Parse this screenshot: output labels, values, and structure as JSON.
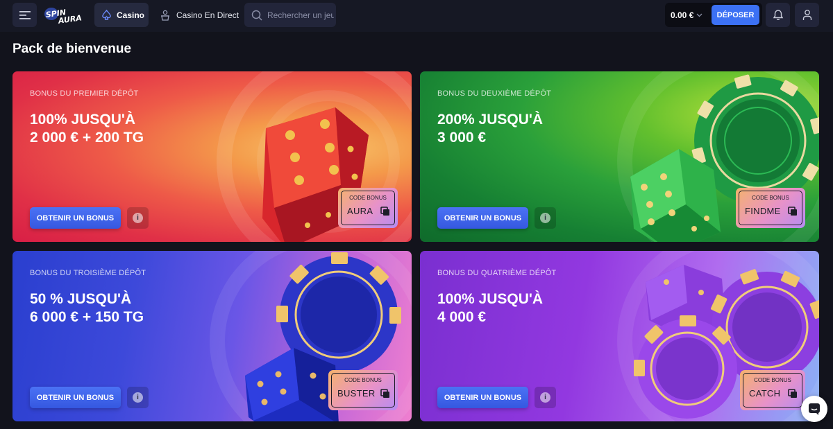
{
  "header": {
    "logo_text": "SPIN AURA",
    "nav": {
      "casino_label": "Casino",
      "live_label": "Casino En Direct"
    },
    "search": {
      "placeholder": "Rechercher un jeu"
    },
    "balance": "0.00 €",
    "deposit_label": "DÉPOSER"
  },
  "page_title": "Pack de bienvenue",
  "cards": [
    {
      "label": "BONUS DU PREMIER DÉPÔT",
      "line1": "100% JUSQU'À",
      "line2": "2 000 € + 200 TG",
      "cta": "OBTENIR UN BONUS",
      "code_label": "CODE BONUS",
      "code": "AURA",
      "theme": "red"
    },
    {
      "label": "BONUS DU DEUXIÈME DÉPÔT",
      "line1": "200% JUSQU'À",
      "line2": "3 000 €",
      "cta": "OBTENIR UN BONUS",
      "code_label": "CODE BONUS",
      "code": "FINDME",
      "theme": "green"
    },
    {
      "label": "BONUS DU TROISIÈME DÉPÔT",
      "line1": "50 % JUSQU'À",
      "line2": "6 000 € + 150 TG",
      "cta": "OBTENIR UN BONUS",
      "code_label": "CODE BONUS",
      "code": "BUSTER",
      "theme": "blue"
    },
    {
      "label": "BONUS DU QUATRIÈME DÉPÔT",
      "line1": "100% JUSQU'À",
      "line2": "4 000 €",
      "cta": "OBTENIR UN BONUS",
      "code_label": "CODE BONUS",
      "code": "CATCH",
      "theme": "purple"
    }
  ],
  "colors": {
    "background": "#12131c",
    "header": "#161824",
    "accent": "#3c71f4",
    "card_red": "#e8374a",
    "card_green": "#1f8a3a",
    "card_blue": "#3f4fd8",
    "card_purple": "#9a3de0"
  },
  "icons": [
    "menu-icon",
    "casino-spade-icon",
    "live-dealer-icon",
    "search-icon",
    "chevron-down-icon",
    "bell-icon",
    "user-icon",
    "info-icon",
    "copy-icon",
    "chat-icon"
  ]
}
